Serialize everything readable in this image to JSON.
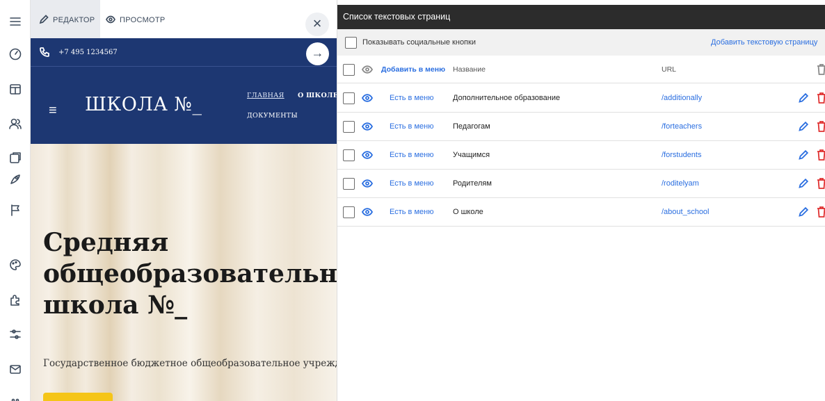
{
  "rail": {
    "icons": [
      "menu-icon",
      "dashboard-icon",
      "store-icon",
      "users-icon",
      "pages-icon",
      "rocket-icon",
      "flag-icon",
      "palette-icon",
      "puzzle-icon",
      "sliders-icon",
      "mail-icon",
      "more-icon"
    ]
  },
  "editor": {
    "tab_editor": "РЕДАКТОР",
    "tab_preview": "ПРОСМОТР",
    "close_label": "×"
  },
  "site": {
    "phone": "+7 495 1234567",
    "arrow": "→",
    "logo": "ШКОЛА №_",
    "nav": {
      "main": "ГЛАВНАЯ",
      "about": "О ШКОЛЕ",
      "docs": "ДОКУМЕНТЫ"
    },
    "hero_title": "Средняя\nобщеобразовательная\nшкола №_",
    "hero_subtitle": "Государственное бюджетное общеобразовательное учреждение"
  },
  "panel": {
    "title": "Список текстовых страниц",
    "show_social_label": "Показывать социальные кнопки",
    "add_page_label": "Добавить текстовую страницу",
    "columns": {
      "menu": "Добавить в меню",
      "name": "Название",
      "url": "URL"
    },
    "rows": [
      {
        "menu": "Есть в меню",
        "name": "Дополнительное образование",
        "url": "/additionally"
      },
      {
        "menu": "Есть в меню",
        "name": "Педагогам",
        "url": "/forteachers"
      },
      {
        "menu": "Есть в меню",
        "name": "Учащимся",
        "url": "/forstudents"
      },
      {
        "menu": "Есть в меню",
        "name": "Родителям",
        "url": "/roditelyam"
      },
      {
        "menu": "Есть в меню",
        "name": "О школе",
        "url": "/about_school"
      }
    ]
  },
  "colors": {
    "site_header": "#1d3772",
    "panel_header": "#2c2c2c",
    "link_blue": "#2a6ee0",
    "delete_red": "#e03030",
    "hero_button": "#f5c518"
  }
}
